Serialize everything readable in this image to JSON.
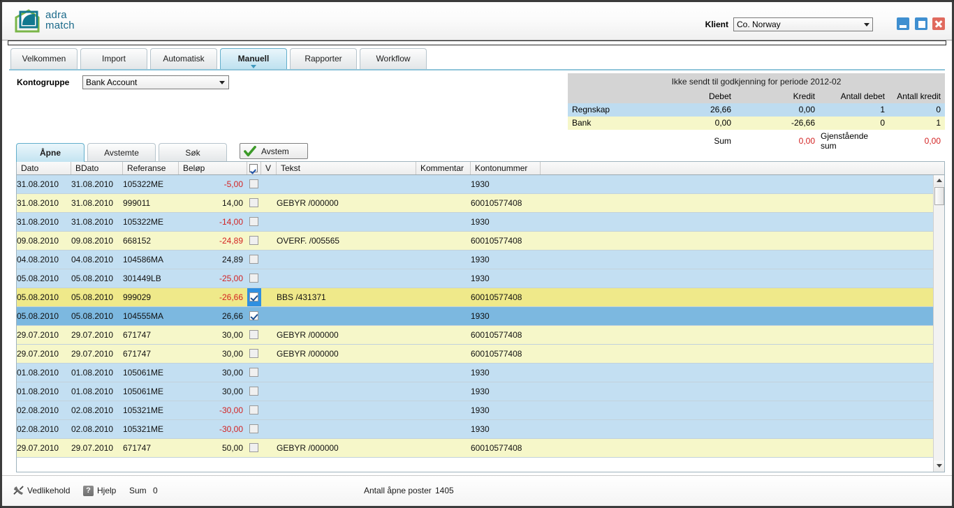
{
  "header": {
    "logo_line1": "adra",
    "logo_line2": "match",
    "klient_label": "Klient",
    "klient_value": "Co. Norway",
    "min_icon": "minimize-icon",
    "max_icon": "maximize-icon",
    "close_icon": "close-icon"
  },
  "tabs": [
    {
      "label": "Velkommen",
      "active": false
    },
    {
      "label": "Import",
      "active": false
    },
    {
      "label": "Automatisk",
      "active": false
    },
    {
      "label": "Manuell",
      "active": true
    },
    {
      "label": "Rapporter",
      "active": false
    },
    {
      "label": "Workflow",
      "active": false
    }
  ],
  "filters": {
    "kontogruppe_label": "Kontogruppe",
    "kontogruppe_value": "Bank Account"
  },
  "summary": {
    "title": "Ikke sendt til godkjenning for periode 2012-02",
    "columns": [
      "",
      "Debet",
      "Kredit",
      "Antall debet",
      "Antall kredit"
    ],
    "rows": [
      {
        "name": "Regnskap",
        "debet": "26,66",
        "kredit": "0,00",
        "antall_debet": "1",
        "antall_kredit": "0"
      },
      {
        "name": "Bank",
        "debet": "0,00",
        "kredit": "-26,66",
        "antall_debet": "0",
        "antall_kredit": "1"
      }
    ],
    "sum_label": "Sum",
    "sum_value": "0,00",
    "gjenstaende_label": "Gjenstående sum",
    "gjenstaende_value": "0,00"
  },
  "subtabs": [
    {
      "label": "Åpne",
      "active": true
    },
    {
      "label": "Avstemte",
      "active": false
    },
    {
      "label": "Søk",
      "active": false
    }
  ],
  "avstem_button": {
    "label": "Avstem",
    "icon": "check-icon"
  },
  "grid": {
    "columns": [
      "Dato",
      "BDato",
      "Referanse",
      "Beløp",
      "",
      "V",
      "Tekst",
      "Kommentar",
      "Kontonummer"
    ],
    "header_checkbox_checked": true,
    "rows": [
      {
        "dato": "31.08.2010",
        "bdato": "31.08.2010",
        "referanse": "105322ME",
        "belop": "-5,00",
        "negative": true,
        "checked": false,
        "tekst": "",
        "kommentar": "",
        "kontonummer": "1930",
        "style": "blue"
      },
      {
        "dato": "31.08.2010",
        "bdato": "31.08.2010",
        "referanse": "999011",
        "belop": "14,00",
        "negative": false,
        "checked": false,
        "tekst": "GEBYR  /000000",
        "kommentar": "",
        "kontonummer": "60010577408",
        "style": "yellow"
      },
      {
        "dato": "31.08.2010",
        "bdato": "31.08.2010",
        "referanse": "105322ME",
        "belop": "-14,00",
        "negative": true,
        "checked": false,
        "tekst": "",
        "kommentar": "",
        "kontonummer": "1930",
        "style": "blue"
      },
      {
        "dato": "09.08.2010",
        "bdato": "09.08.2010",
        "referanse": "668152",
        "belop": "-24,89",
        "negative": true,
        "checked": false,
        "tekst": "OVERF. /005565",
        "kommentar": "",
        "kontonummer": "60010577408",
        "style": "yellow"
      },
      {
        "dato": "04.08.2010",
        "bdato": "04.08.2010",
        "referanse": "104586MA",
        "belop": "24,89",
        "negative": false,
        "checked": false,
        "tekst": "",
        "kommentar": "",
        "kontonummer": "1930",
        "style": "blue"
      },
      {
        "dato": "05.08.2010",
        "bdato": "05.08.2010",
        "referanse": "301449LB",
        "belop": "-25,00",
        "negative": true,
        "checked": false,
        "tekst": "",
        "kommentar": "",
        "kontonummer": "1930",
        "style": "blue"
      },
      {
        "dato": "05.08.2010",
        "bdato": "05.08.2010",
        "referanse": "999029",
        "belop": "-26,66",
        "negative": true,
        "checked": true,
        "tekst": "BBS   /431371",
        "kommentar": "",
        "kontonummer": "60010577408",
        "style": "sel-yellow"
      },
      {
        "dato": "05.08.2010",
        "bdato": "05.08.2010",
        "referanse": "104555MA",
        "belop": "26,66",
        "negative": false,
        "checked": true,
        "tekst": "",
        "kommentar": "",
        "kontonummer": "1930",
        "style": "sel-blue"
      },
      {
        "dato": "29.07.2010",
        "bdato": "29.07.2010",
        "referanse": "671747",
        "belop": "30,00",
        "negative": false,
        "checked": false,
        "tekst": "GEBYR /000000",
        "kommentar": "",
        "kontonummer": "60010577408",
        "style": "yellow"
      },
      {
        "dato": "29.07.2010",
        "bdato": "29.07.2010",
        "referanse": "671747",
        "belop": "30,00",
        "negative": false,
        "checked": false,
        "tekst": "GEBYR /000000",
        "kommentar": "",
        "kontonummer": "60010577408",
        "style": "yellow"
      },
      {
        "dato": "01.08.2010",
        "bdato": "01.08.2010",
        "referanse": "105061ME",
        "belop": "30,00",
        "negative": false,
        "checked": false,
        "tekst": "",
        "kommentar": "",
        "kontonummer": "1930",
        "style": "blue"
      },
      {
        "dato": "01.08.2010",
        "bdato": "01.08.2010",
        "referanse": "105061ME",
        "belop": "30,00",
        "negative": false,
        "checked": false,
        "tekst": "",
        "kommentar": "",
        "kontonummer": "1930",
        "style": "blue"
      },
      {
        "dato": "02.08.2010",
        "bdato": "02.08.2010",
        "referanse": "105321ME",
        "belop": "-30,00",
        "negative": true,
        "checked": false,
        "tekst": "",
        "kommentar": "",
        "kontonummer": "1930",
        "style": "blue"
      },
      {
        "dato": "02.08.2010",
        "bdato": "02.08.2010",
        "referanse": "105321ME",
        "belop": "-30,00",
        "negative": true,
        "checked": false,
        "tekst": "",
        "kommentar": "",
        "kontonummer": "1930",
        "style": "blue"
      },
      {
        "dato": "29.07.2010",
        "bdato": "29.07.2010",
        "referanse": "671747",
        "belop": "50,00",
        "negative": false,
        "checked": false,
        "tekst": "GEBYR /000000",
        "kommentar": "",
        "kontonummer": "60010577408",
        "style": "yellow"
      }
    ]
  },
  "statusbar": {
    "vedlikehold_label": "Vedlikehold",
    "vedlikehold_icon": "wrench-icon",
    "hjelp_label": "Hjelp",
    "hjelp_icon": "help-icon",
    "sum_label": "Sum",
    "sum_value": "0",
    "antall_label": "Antall åpne poster",
    "antall_value": "1405"
  },
  "colors": {
    "accent": "#3f98bd",
    "row_blue": "#c3dff2",
    "row_yellow": "#f6f7c9",
    "selected_blue": "#7cb8e0",
    "selected_yellow": "#efe98a",
    "negative": "#d32222"
  }
}
